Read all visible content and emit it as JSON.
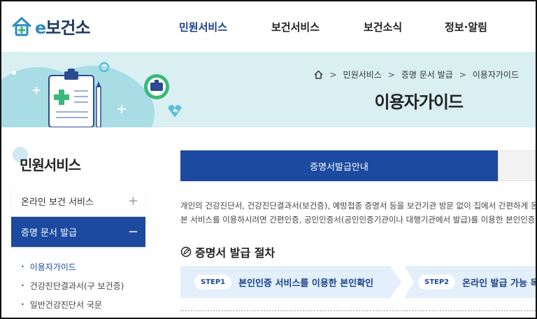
{
  "header": {
    "logo_e": "e",
    "logo_text": "보건소",
    "nav": [
      {
        "label": "민원서비스"
      },
      {
        "label": "보건서비스"
      },
      {
        "label": "보건소식"
      },
      {
        "label": "정보·알림"
      }
    ]
  },
  "banner": {
    "breadcrumb": [
      "민원서비스",
      "증명 문서 발급",
      "이용자가이드"
    ],
    "title": "이용자가이드"
  },
  "sidebar": {
    "title": "민원서비스",
    "menu": [
      {
        "label": "온라인 보건 서비스",
        "sign": "+"
      },
      {
        "label": "증명 문서 발급",
        "sign": "−"
      }
    ],
    "submenu": [
      {
        "label": "이용자가이드"
      },
      {
        "label": "건강진단결과서(구 보건증)"
      },
      {
        "label": "일반건강진단서 국문"
      }
    ]
  },
  "main": {
    "tabs": [
      {
        "label": "증명서발급안내"
      },
      {
        "label": ""
      }
    ],
    "description": [
      "개인의 건강진단서, 건강진단결과서(보건증), 예방접종 증명서 등을 보건기관 방문 없이 집에서 간편하게 온라인",
      "본 서비스를 이용하시려면 간편인증, 공인인증서(공인인증기관이나 대행기관에서 발급)를 이용한 본인인증이"
    ],
    "section_title": "증명서 발급 절차",
    "steps": [
      {
        "badge": "STEP1",
        "text": "본인인증 서비스를 이용한 본인확인"
      },
      {
        "badge": "STEP2",
        "text": "온라인 발급 가능 목록"
      }
    ]
  },
  "colors": {
    "primary": "#1b4aa0",
    "banner_bg": "#d9eff2",
    "step_bg": "#e3f0fb"
  }
}
